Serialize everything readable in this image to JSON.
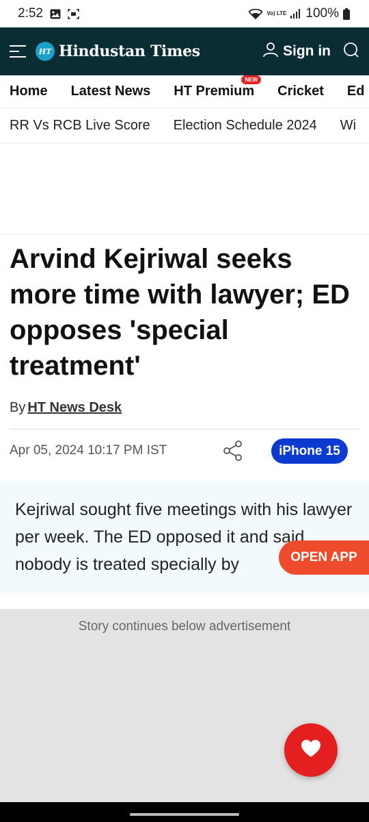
{
  "status_bar": {
    "time": "2:52",
    "battery": "100%",
    "network_label": "Vo) LTE",
    "icons": [
      "image-icon",
      "screenshot-icon",
      "wifi-icon",
      "signal-icon",
      "battery-icon"
    ]
  },
  "header": {
    "logo_badge": "HT",
    "logo_text": "Hindustan Times",
    "signin_label": "Sign in",
    "bg_color": "#0a2d33"
  },
  "nav": {
    "items": [
      {
        "label": "Home"
      },
      {
        "label": "Latest News"
      },
      {
        "label": "HT Premium",
        "badge": "NEW"
      },
      {
        "label": "Cricket"
      },
      {
        "label": "Ed"
      }
    ]
  },
  "subnav": {
    "items": [
      "RR Vs RCB Live Score",
      "Election Schedule 2024",
      "Wi"
    ]
  },
  "article": {
    "headline": "Arvind Kejriwal seeks more time with lawyer; ED opposes 'special treatment'",
    "byline_prefix": "By",
    "author": "HT News Desk",
    "date": "Apr 05, 2024 10:17 PM IST",
    "topic_pill": "iPhone 15",
    "summary": "Kejriwal sought five meetings with his lawyer per week. The ED opposed it and said nobody is treated specially by"
  },
  "open_app_label": "OPEN APP",
  "ad": {
    "label": "Story continues below advertisement"
  },
  "colors": {
    "accent_blue": "#0b3ccf",
    "open_app": "#ee4a2c",
    "fab_red": "#e41f20",
    "badge_red": "#e32323"
  }
}
